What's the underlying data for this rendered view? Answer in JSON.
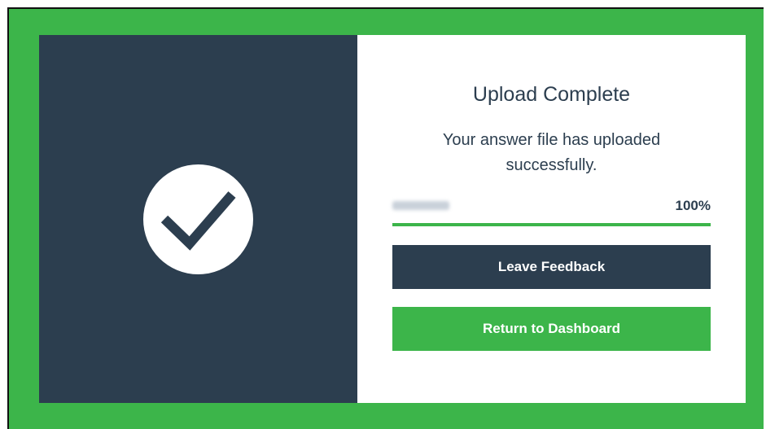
{
  "colors": {
    "frame": "#3cb54a",
    "panel": "#2c3e4f",
    "text": "#2c3e4f"
  },
  "icons": {
    "status": "checkmark-circle-icon"
  },
  "dialog": {
    "title": "Upload Complete",
    "message": "Your answer file has uploaded successfully.",
    "progress": {
      "percent_label": "100%",
      "value": 100
    },
    "buttons": {
      "feedback_label": "Leave Feedback",
      "dashboard_label": "Return to Dashboard"
    }
  }
}
